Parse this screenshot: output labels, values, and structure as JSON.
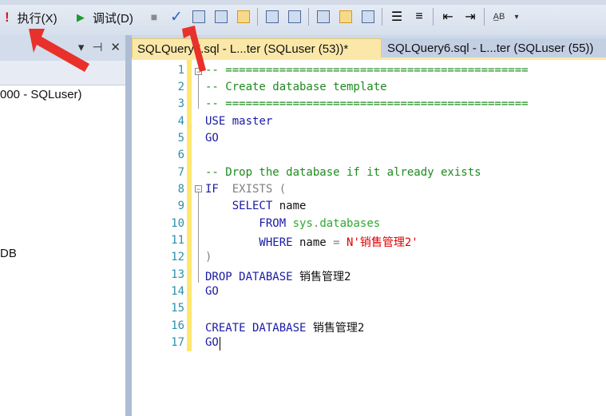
{
  "toolbar": {
    "execute_label": "执行(X)",
    "debug_label": "调试(D)",
    "icons": [
      "execute-icon",
      "debug-play-icon",
      "stop-icon",
      "parse-check-icon",
      "query-plan-icon",
      "results-icon",
      "grid-icon",
      "include-stats-icon",
      "plan-icon",
      "text-results-icon",
      "grid-results-icon",
      "file-results-icon",
      "comment-icon",
      "uncomment-icon",
      "outdent-icon",
      "indent-icon",
      "specify-values-icon"
    ]
  },
  "left_panel": {
    "header_icons": [
      "▾",
      "⊣",
      "✕"
    ],
    "server_node": "000 - SQLuser)",
    "db_node": "DB"
  },
  "tabs": [
    {
      "label": "SQLQuery7.sql - L...ter (SQLuser (53))*",
      "active": true
    },
    {
      "label": "SQLQuery6.sql - L...ter (SQLuser (55))",
      "active": false
    }
  ],
  "editor": {
    "line_numbers": [
      "1",
      "2",
      "3",
      "4",
      "5",
      "6",
      "7",
      "8",
      "9",
      "10",
      "11",
      "12",
      "13",
      "14",
      "15",
      "16",
      "17"
    ],
    "lines": {
      "l1": "-- =============================================",
      "l2": "-- Create database template",
      "l3": "-- =============================================",
      "l4a": "USE",
      "l4b": " master",
      "l5": "GO",
      "l7": "-- Drop the database if it already exists",
      "l8a": "IF",
      "l8b": "  EXISTS",
      "l8c": " (",
      "l9a": "    SELECT",
      "l9b": " name",
      "l10a": "        FROM",
      "l10b": " sys",
      "l10c": ".",
      "l10d": "databases",
      "l11a": "        WHERE",
      "l11b": " name ",
      "l11c": "=",
      "l11d": " N'销售管理2'",
      "l12": ")",
      "l13a": "DROP DATABASE",
      "l13b": " 销售管理2",
      "l14": "GO",
      "l16a": "CREATE DATABASE",
      "l16b": " 销售管理2",
      "l17": "GO"
    }
  },
  "colors": {
    "keyword": "#1a1aa6",
    "comment": "#1f8a1f",
    "string": "#e00000",
    "annotation_arrow": "#e8312a"
  }
}
